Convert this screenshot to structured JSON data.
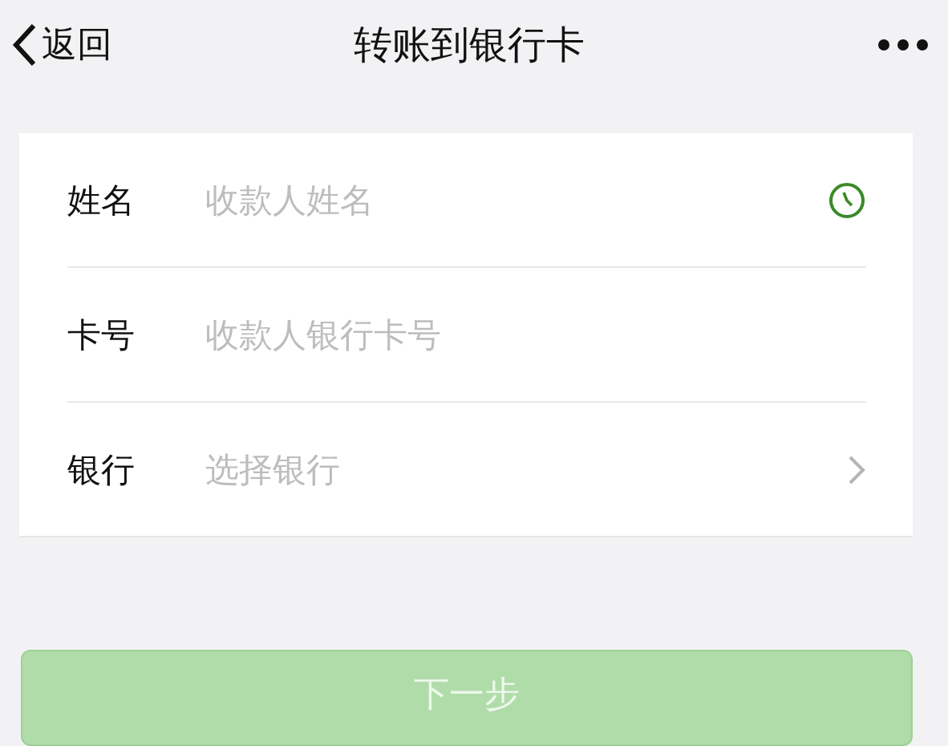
{
  "nav_bar": {
    "back_label": "返回",
    "title": "转账到银行卡"
  },
  "form": {
    "rows": [
      {
        "label": "姓名",
        "placeholder": "收款人姓名",
        "kind": "recent"
      },
      {
        "label": "卡号",
        "placeholder": "收款人银行卡号",
        "kind": "input"
      },
      {
        "label": "银行",
        "placeholder": "选择银行",
        "kind": "select"
      }
    ]
  },
  "next_button": {
    "label": "下一步",
    "disabled": true
  }
}
